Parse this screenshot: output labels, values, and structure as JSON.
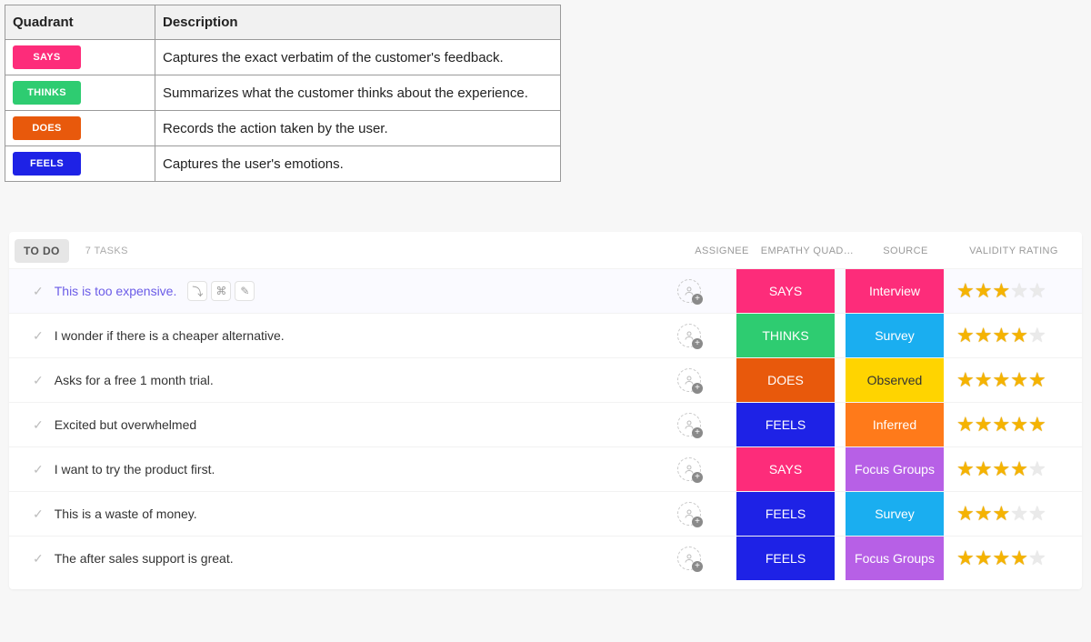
{
  "quadTable": {
    "headers": [
      "Quadrant",
      "Description"
    ],
    "rows": [
      {
        "badge": "SAYS",
        "color": "c-says",
        "desc": "Captures the exact verbatim of the customer's feedback."
      },
      {
        "badge": "THINKS",
        "color": "c-thinks",
        "desc": "Summarizes what the customer thinks about the experience."
      },
      {
        "badge": "DOES",
        "color": "c-does",
        "desc": "Records the action taken by the user."
      },
      {
        "badge": "FEELS",
        "color": "c-feels",
        "desc": "Captures the user's emotions."
      }
    ]
  },
  "taskList": {
    "status": "TO DO",
    "count": "7 TASKS",
    "columns": {
      "assignee": "ASSIGNEE",
      "quadrant": "EMPATHY QUAD…",
      "source": "SOURCE",
      "validity": "VALIDITY RATING"
    },
    "rows": [
      {
        "title": "This is too expensive.",
        "selected": true,
        "quad": "SAYS",
        "quadColor": "c-says",
        "source": "Interview",
        "sourceClass": "s-interview",
        "rating": 3
      },
      {
        "title": "I wonder if there is a cheaper alternative.",
        "selected": false,
        "quad": "THINKS",
        "quadColor": "c-thinks",
        "source": "Survey",
        "sourceClass": "s-survey",
        "rating": 4
      },
      {
        "title": "Asks for a free 1 month trial.",
        "selected": false,
        "quad": "DOES",
        "quadColor": "c-does",
        "source": "Observed",
        "sourceClass": "s-observed",
        "rating": 5
      },
      {
        "title": "Excited but overwhelmed",
        "selected": false,
        "quad": "FEELS",
        "quadColor": "c-feels",
        "source": "Inferred",
        "sourceClass": "s-inferred",
        "rating": 5
      },
      {
        "title": "I want to try the product first.",
        "selected": false,
        "quad": "SAYS",
        "quadColor": "c-says",
        "source": "Focus Groups",
        "sourceClass": "s-focus",
        "rating": 4
      },
      {
        "title": "This is a waste of money.",
        "selected": false,
        "quad": "FEELS",
        "quadColor": "c-feels",
        "source": "Survey",
        "sourceClass": "s-survey",
        "rating": 3
      },
      {
        "title": "The after sales support is great.",
        "selected": false,
        "quad": "FEELS",
        "quadColor": "c-feels",
        "source": "Focus Groups",
        "sourceClass": "s-focus",
        "rating": 4
      }
    ]
  }
}
